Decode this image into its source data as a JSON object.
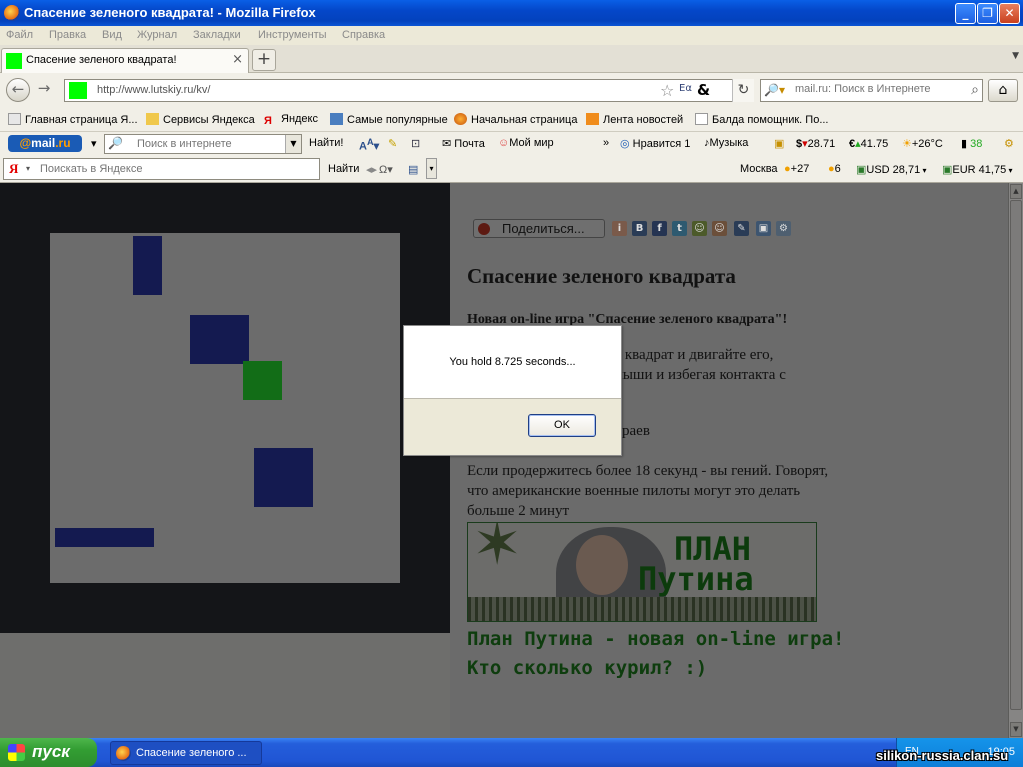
{
  "window": {
    "title": "Спасение зеленого квадрата! - Mozilla Firefox"
  },
  "menu": [
    "Файл",
    "Правка",
    "Вид",
    "Журнал",
    "Закладки",
    "Инструменты",
    "Справка"
  ],
  "tab": {
    "title": "Спасение зеленого квадрата!"
  },
  "nav": {
    "url": "http://www.lutskiy.ru/kv/",
    "search_placeholder": "mail.ru: Поиск в Интернете"
  },
  "bookmarks": [
    "Главная страница Я...",
    "Сервисы Яндекса",
    "Яндекс",
    "Самые популярные",
    "Начальная страница",
    "Лента новостей",
    "Балда помощник. По..."
  ],
  "mailbar": {
    "logo_at": "@",
    "logo_mail": "mail",
    "logo_ru": ".ru",
    "search_placeholder": "Поиск в интернете",
    "find": "Найти!",
    "mail": "Почта",
    "myworld": "Мой мир",
    "like": "Нравится 1",
    "music": "Музыка",
    "usd": "28.71",
    "eur": "41.75",
    "weather": "+26°C",
    "traffic": "38"
  },
  "yabar": {
    "logo": "Я",
    "search_placeholder": "Поискать в Яндексе",
    "find": "Найти",
    "city": "Москва",
    "temp": "+27",
    "traffic": "6",
    "usd": "USD 28,71",
    "eur": "EUR 41,75"
  },
  "page": {
    "share": "Поделиться...",
    "heading": "Спасение зеленого квадрата",
    "subtitle": "Новая on-line игра \"Спасение зеленого квадрата\"!",
    "line1": "ный квадрат и двигайте его,",
    "line2": "ку мыши и избегая контакта с",
    "line3": "с",
    "line4": "раев",
    "line5": "Если продержитесь более 18 секунд - вы гений. Говорят,",
    "line6": "что американские военные пилоты могут это делать",
    "line7": "больше 2 минут",
    "banner_line1": "ПЛАН",
    "banner_line2": "Путина",
    "promo1": "План Путина - новая on-line игра!",
    "promo2": "Кто сколько курил? :)"
  },
  "dialog": {
    "message": "You hold 8.725 seconds...",
    "ok": "OK"
  },
  "taskbar": {
    "start": "пуск",
    "item": "Спасение зеленого ...",
    "lang": "EN",
    "clock": "19:05"
  },
  "watermark": "silikon-russia.clan.su",
  "colors": {
    "player": "#126d17",
    "enemy": "#141a50",
    "titlebar": "#0447c9"
  }
}
